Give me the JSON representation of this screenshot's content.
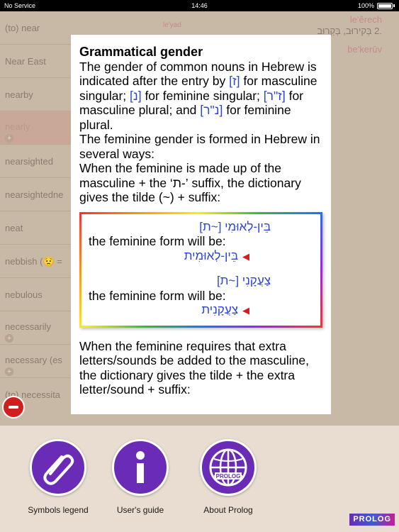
{
  "status_bar": {
    "carrier": "No Service",
    "time": "14:46",
    "battery": "100%"
  },
  "background_list": {
    "top_strip": "le'yad",
    "items": [
      {
        "label": "(to) near"
      },
      {
        "label": "Near East"
      },
      {
        "label": "nearby"
      },
      {
        "label": "nearly"
      },
      {
        "label": "nearsighted"
      },
      {
        "label": "nearsightedne"
      },
      {
        "label": "neat"
      },
      {
        "label": "nebbish (😟 ="
      },
      {
        "label": "nebulous"
      },
      {
        "label": "necessarily"
      },
      {
        "label": "necessary (es"
      },
      {
        "label": "(to) necessita"
      }
    ],
    "right_panel": {
      "translit1": "le'ĕrech",
      "hebrew": ".2 בְּקירוּב, בְּקֵרוּב",
      "translit2": "be'kerūv"
    }
  },
  "popup": {
    "title": "Grammatical gender",
    "p1_a": "The gender of common nouns in Hebrew is indicated after the entry by ",
    "p1_masc_sing": "[ז]",
    "p1_b": " for masculine singular; ",
    "p1_fem_sing": "[נ]",
    "p1_c": " for feminine singular; ",
    "p1_masc_pl": "[ז\"ר]",
    "p1_d": " for masculine plural; and ",
    "p1_fem_pl": "[נ\"ר]",
    "p1_e": " for feminine plural.",
    "p2_a": "The feminine gender is formed in Hebrew in several ways:",
    "p2_b": "When the feminine is made up of the masculine + the ‘ת-’ suffix, the dictionary gives the tilde (~) + suffix:",
    "example1_heb": "בֵּין-לְאוּמִי [~ת]",
    "example_caption": "the feminine form will be:",
    "example1_result": "בֵּין-לְאוּמִית",
    "example2_heb": "צַעֲקָנִי [~ת]",
    "example2_result": "צַעֲקָנִית",
    "p3": "When the feminine requires that extra letters/sounds be added to the masculine, the dictionary gives the tilde + the extra letter/sound + suffix:"
  },
  "toolbar": {
    "symbols_legend": "Symbols legend",
    "users_guide": "User's guide",
    "about_prolog": "About Prolog",
    "globe_badge": "PROLOG",
    "logo": "PROLOG"
  },
  "colors": {
    "accent_purple": "#6a2bb6",
    "hebrew_blue": "#2a44d6",
    "arrow_red": "#d11e1e"
  }
}
